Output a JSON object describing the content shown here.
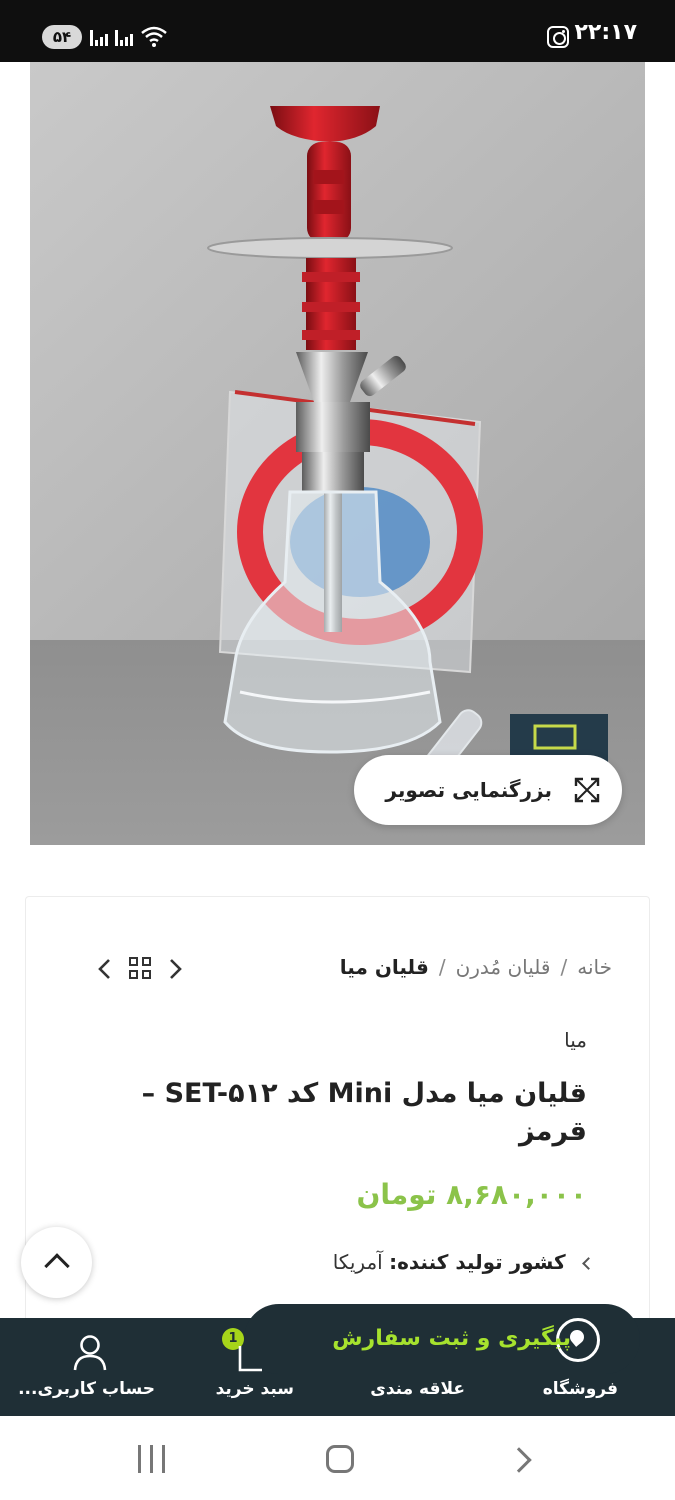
{
  "status_bar": {
    "time": "۲۲:۱۷",
    "battery": "۵۴",
    "icons": [
      "instagram-icon",
      "signal-icon",
      "wifi-icon"
    ]
  },
  "gallery": {
    "zoom_label": "بزرگنمایی تصویر",
    "zoom_icon": "expand-icon"
  },
  "breadcrumb": {
    "items": [
      "خانه",
      "قلیان مُدرن",
      "قلیان میا"
    ],
    "separator": "/"
  },
  "product": {
    "brand": "میا",
    "title": "قلیان میا مدل Mini کد SET-۵۱۲ – قرمز",
    "price": "۸,۶۸۰,۰۰۰ تومان",
    "price_color": "#8bc34a",
    "spec_label": "کشور تولید کننده:",
    "spec_value": "آمریکا"
  },
  "whatsapp": {
    "label": "پیگیری و ثبت سفارش",
    "label_color": "#a6e22e"
  },
  "bottom_nav": {
    "items": [
      {
        "label": "فروشگاه",
        "icon": "store-icon"
      },
      {
        "label": "علاقه مندی",
        "icon": "heart-icon"
      },
      {
        "label": "سبد خرید",
        "icon": "cart-icon"
      },
      {
        "label": "حساب کاربری...",
        "icon": "user-icon"
      }
    ],
    "cart_count": "1",
    "background": "#1f2f36"
  }
}
